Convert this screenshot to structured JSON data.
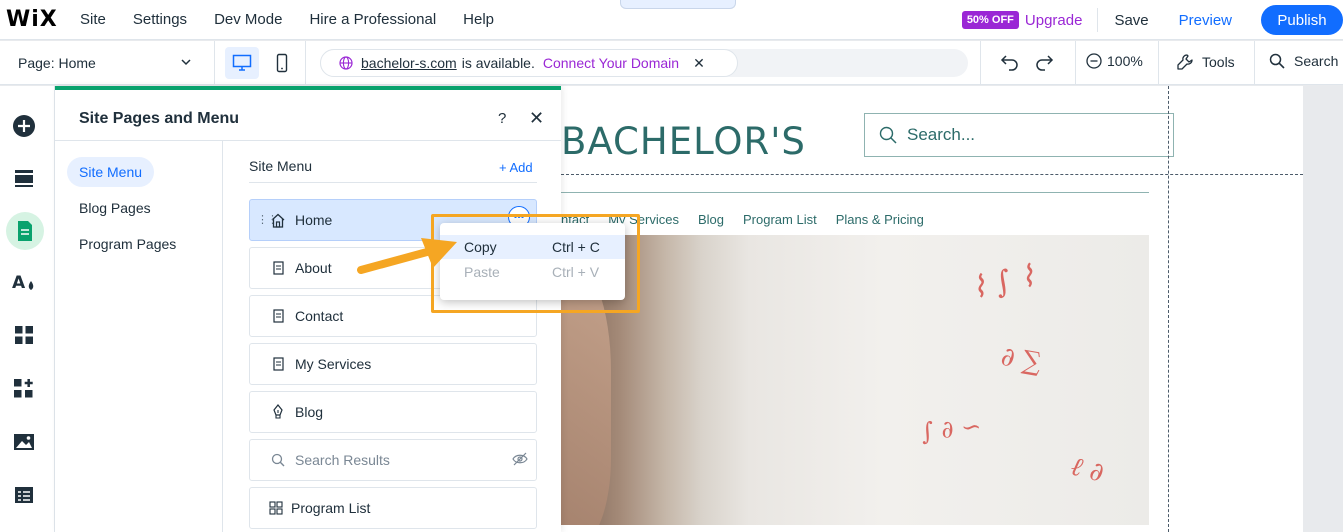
{
  "topbar": {
    "logo": "WiX",
    "menu": [
      "Site",
      "Settings",
      "Dev Mode",
      "Hire a Professional",
      "Help"
    ],
    "badge": "50% OFF",
    "upgrade": "Upgrade",
    "save": "Save",
    "preview": "Preview",
    "publish": "Publish"
  },
  "bar2": {
    "page_label": "Page: Home",
    "domain": "bachelor-s.com",
    "available_text": "is available.",
    "connect": "Connect Your Domain",
    "zoom": "100%",
    "tools": "Tools",
    "search": "Search"
  },
  "panel": {
    "title": "Site Pages and Menu",
    "help": "?",
    "tabs": [
      "Site Menu",
      "Blog Pages",
      "Program Pages"
    ],
    "menu_heading": "Site Menu",
    "add_label": "+ Add",
    "pages": [
      {
        "label": "Home",
        "icon": "home-icon"
      },
      {
        "label": "About",
        "icon": "page-icon"
      },
      {
        "label": "Contact",
        "icon": "page-icon"
      },
      {
        "label": "My Services",
        "icon": "page-icon"
      },
      {
        "label": "Blog",
        "icon": "pen-icon"
      },
      {
        "label": "Search Results",
        "icon": "search-icon",
        "hidden": true
      },
      {
        "label": "Program List",
        "icon": "grid-icon"
      }
    ]
  },
  "context_menu": {
    "items": [
      {
        "label": "Copy",
        "shortcut": "Ctrl + C",
        "enabled": true
      },
      {
        "label": "Paste",
        "shortcut": "Ctrl + V",
        "enabled": false
      }
    ]
  },
  "site": {
    "title": "BACHELOR'S",
    "search_placeholder": "Search...",
    "nav": [
      "ntact",
      "My Services",
      "Blog",
      "Program List",
      "Plans & Pricing"
    ]
  },
  "colors": {
    "accent": "#116dff",
    "upgrade": "#9a27d5",
    "panel_top": "#09a26d",
    "site_text": "#2c6b69",
    "highlight": "#f5a623"
  }
}
